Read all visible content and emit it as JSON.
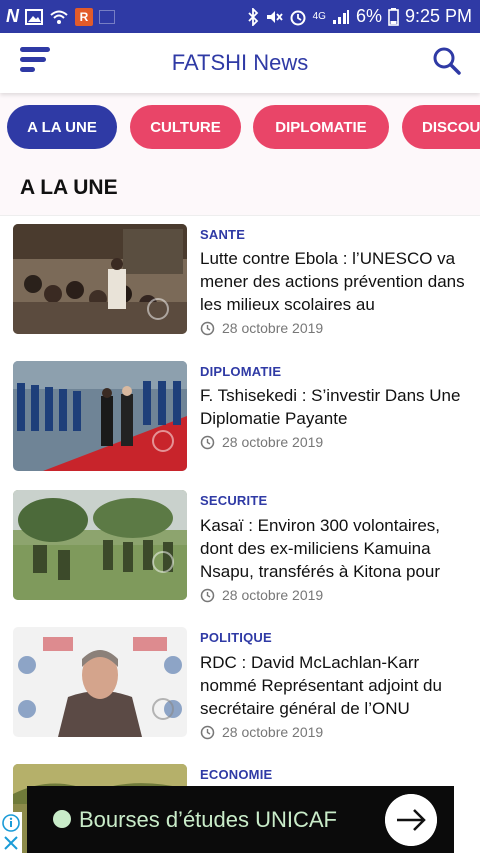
{
  "status_bar": {
    "battery": "6%",
    "time": "9:25 PM",
    "network": "4G"
  },
  "header": {
    "title": "FATSHI News"
  },
  "tabs": [
    {
      "label": "A LA UNE"
    },
    {
      "label": "CULTURE"
    },
    {
      "label": "DIPLOMATIE"
    },
    {
      "label": "DISCOU"
    }
  ],
  "section": {
    "title": "A LA UNE"
  },
  "articles": [
    {
      "category": "SANTE",
      "title": "Lutte contre Ebola : l’UNESCO va mener des actions prévention dans les milieux scolaires au",
      "date": "28 octobre 2019"
    },
    {
      "category": "DIPLOMATIE",
      "title": "F. Tshisekedi : S’investir Dans Une Diplomatie Payante",
      "date": "28 octobre 2019"
    },
    {
      "category": "SECURITE",
      "title": "Kasaï : Environ 300 volontaires, dont des ex-miliciens Kamuina Nsapu, transférés à Kitona pour",
      "date": "28 octobre 2019"
    },
    {
      "category": "POLITIQUE",
      "title": "RDC : David McLachlan-Karr nommé Représentant adjoint du secrétaire général de l’ONU",
      "date": "28 octobre 2019"
    },
    {
      "category": "ECONOMIE",
      "title": "",
      "date": ""
    }
  ],
  "ad": {
    "text": "Bourses d’études UNICAF"
  },
  "colors": {
    "brand": "#2f3aa5",
    "tab_inactive": "#e94568"
  }
}
